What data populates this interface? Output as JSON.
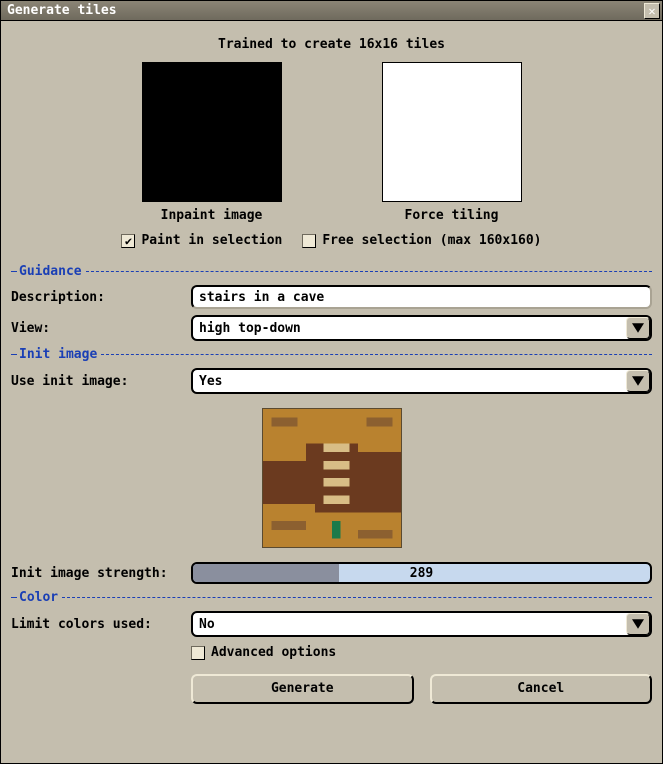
{
  "title": "Generate tiles",
  "trained_header": "Trained to create 16x16 tiles",
  "thumbs": {
    "inpaint_label": "Inpaint image",
    "force_label": "Force tiling"
  },
  "options": {
    "paint_in_selection": {
      "label": "Paint in selection",
      "checked": true
    },
    "free_selection": {
      "label": "Free selection (max 160x160)",
      "checked": false
    }
  },
  "sections": {
    "guidance": "Guidance",
    "init_image": "Init image",
    "color": "Color"
  },
  "guidance": {
    "description_label": "Description:",
    "description_value": "stairs in a cave",
    "view_label": "View:",
    "view_value": "high top-down"
  },
  "init": {
    "use_label": "Use init image:",
    "use_value": "Yes",
    "strength_label": "Init image strength:",
    "strength_value": "289",
    "strength_fill_pct": 32
  },
  "color": {
    "limit_label": "Limit colors used:",
    "limit_value": "No"
  },
  "advanced": {
    "label": "Advanced options",
    "checked": false
  },
  "buttons": {
    "generate": "Generate",
    "cancel": "Cancel"
  },
  "palette": {
    "bg": "#c4beae",
    "accent": "#1a3fb5",
    "slider_fill": "#8a8f9e",
    "slider_bg": "#c7d9ee"
  }
}
